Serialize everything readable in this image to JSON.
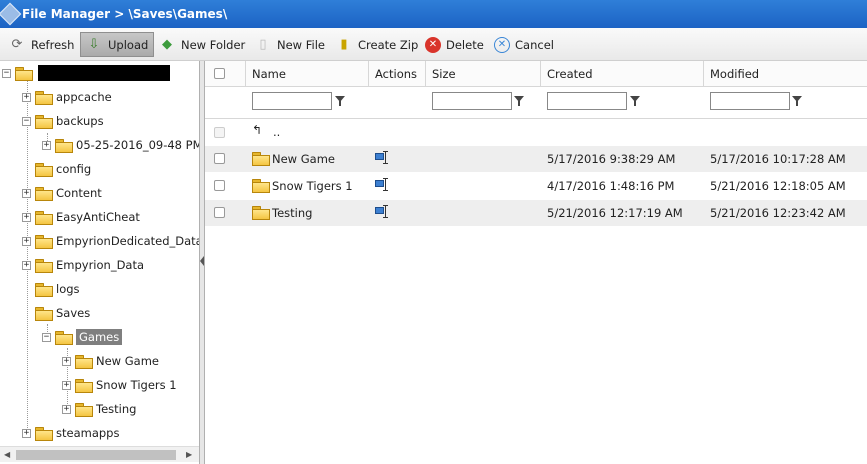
{
  "titlebar": {
    "title": "File Manager > \\Saves\\Games\\"
  },
  "toolbar": {
    "refresh": "Refresh",
    "upload": "Upload",
    "new_folder": "New Folder",
    "new_file": "New File",
    "create_zip": "Create Zip",
    "delete": "Delete",
    "cancel": "Cancel"
  },
  "tree": {
    "root_label": "",
    "items": [
      {
        "label": "appcache"
      },
      {
        "label": "backups"
      },
      {
        "label": "05-25-2016_09-48 PM"
      },
      {
        "label": "config"
      },
      {
        "label": "Content"
      },
      {
        "label": "EasyAntiCheat"
      },
      {
        "label": "EmpyrionDedicated_Data"
      },
      {
        "label": "Empyrion_Data"
      },
      {
        "label": "logs"
      },
      {
        "label": "Saves"
      },
      {
        "label": "Games"
      },
      {
        "label": "New Game"
      },
      {
        "label": "Snow Tigers 1"
      },
      {
        "label": "Testing"
      },
      {
        "label": "steamapps"
      }
    ]
  },
  "grid": {
    "columns": {
      "name": "Name",
      "actions": "Actions",
      "size": "Size",
      "created": "Created",
      "modified": "Modified"
    },
    "up_label": "..",
    "rows": [
      {
        "name": "New Game",
        "size": "",
        "created": "5/17/2016 9:38:29 AM",
        "modified": "5/17/2016 10:17:28 AM"
      },
      {
        "name": "Snow Tigers 1",
        "size": "",
        "created": "4/17/2016 1:48:16 PM",
        "modified": "5/21/2016 12:18:05 AM"
      },
      {
        "name": "Testing",
        "size": "",
        "created": "5/21/2016 12:17:19 AM",
        "modified": "5/21/2016 12:23:42 AM"
      }
    ]
  },
  "colors": {
    "titlebar": "#1c63c4",
    "folder": "#f4c542",
    "delete": "#d9342b",
    "cancel": "#3a86d6"
  }
}
